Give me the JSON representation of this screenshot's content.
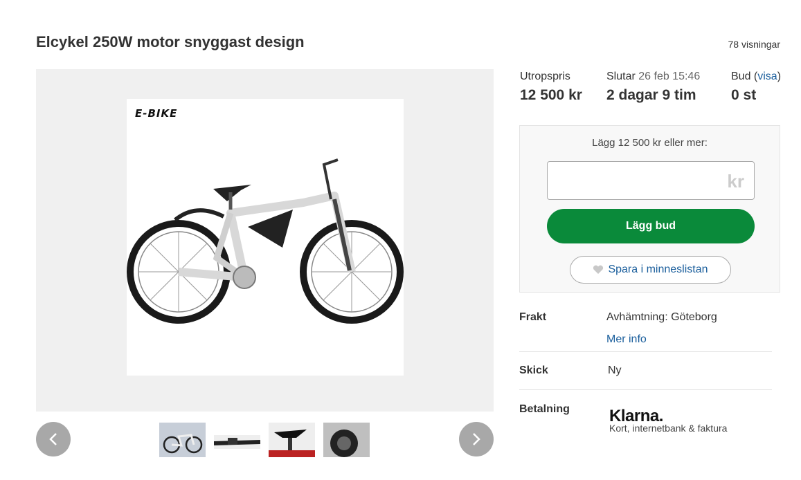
{
  "listing": {
    "title": "Elcykel 250W motor snyggast design",
    "views": "78 visningar"
  },
  "gallery": {
    "brand_logo": "E-BIKE",
    "thumbnails": [
      "thumb-1",
      "thumb-2",
      "thumb-3",
      "thumb-4"
    ]
  },
  "stats": {
    "start_price_label": "Utropspris",
    "start_price_value": "12 500 kr",
    "ends_label": "Slutar",
    "ends_date": "26 feb 15:46",
    "ends_value": "2 dagar 9 tim",
    "bids_label": "Bud",
    "bids_link_open": "(",
    "bids_link": "visa",
    "bids_link_close": ")",
    "bids_value": "0 st"
  },
  "bid": {
    "hint": "Lägg 12 500 kr eller mer:",
    "input_placeholder": "",
    "unit": "kr",
    "button_label": "Lägg bud",
    "save_label": "Spara i minneslistan"
  },
  "info": {
    "shipping_label": "Frakt",
    "shipping_value": "Avhämtning: Göteborg",
    "shipping_link": "Mer info",
    "condition_label": "Skick",
    "condition_value": "Ny",
    "payment_label": "Betalning",
    "klarna_logo": "Klarna.",
    "klarna_sub": "Kort, internetbank & faktura"
  },
  "colors": {
    "accent_green": "#0a8a3a",
    "link_blue": "#1a5e9c"
  }
}
